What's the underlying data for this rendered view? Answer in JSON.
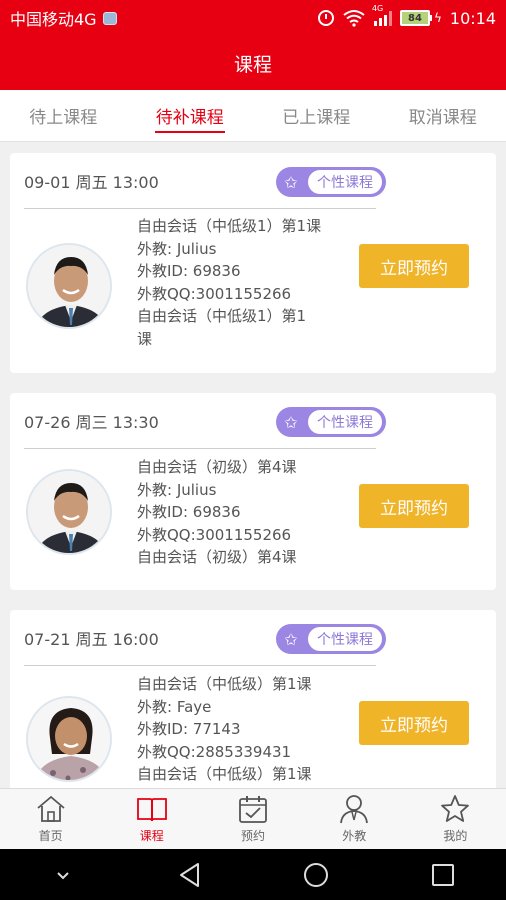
{
  "status_bar": {
    "carrier": "中国移动4G",
    "network_tag": "4G",
    "battery": "84",
    "time": "10:14"
  },
  "header": {
    "title": "课程"
  },
  "tabs": [
    {
      "label": "待上课程",
      "active": false
    },
    {
      "label": "待补课程",
      "active": true
    },
    {
      "label": "已上课程",
      "active": false
    },
    {
      "label": "取消课程",
      "active": false
    }
  ],
  "cards": [
    {
      "datetime": "09-01  周五  13:00",
      "badge": "个性课程",
      "lines": [
        "自由会话（中低级1）第1课",
        "外教: Julius",
        "外教ID: 69836",
        "外教QQ:3001155266",
        "自由会话（中低级1）第1",
        "课"
      ],
      "button": "立即预约"
    },
    {
      "datetime": "07-26  周三  13:30",
      "badge": "个性课程",
      "lines": [
        "自由会话（初级）第4课",
        "外教: Julius",
        "外教ID: 69836",
        "外教QQ:3001155266",
        "自由会话（初级）第4课"
      ],
      "button": "立即预约"
    },
    {
      "datetime": "07-21  周五  16:00",
      "badge": "个性课程",
      "lines": [
        "自由会话（中低级）第1课",
        "外教: Faye",
        "外教ID: 77143",
        "外教QQ:2885339431",
        "自由会话（中低级）第1课"
      ],
      "button": "立即预约"
    }
  ],
  "bottom_nav": [
    {
      "label": "首页",
      "icon": "home-icon",
      "active": false
    },
    {
      "label": "课程",
      "icon": "book-icon",
      "active": true
    },
    {
      "label": "预约",
      "icon": "calendar-check-icon",
      "active": false
    },
    {
      "label": "外教",
      "icon": "teacher-icon",
      "active": false
    },
    {
      "label": "我的",
      "icon": "star-icon",
      "active": false
    }
  ],
  "colors": {
    "brand_red": "#e60012",
    "button_yellow": "#f0b429",
    "badge_purple": "#9b87e3"
  }
}
